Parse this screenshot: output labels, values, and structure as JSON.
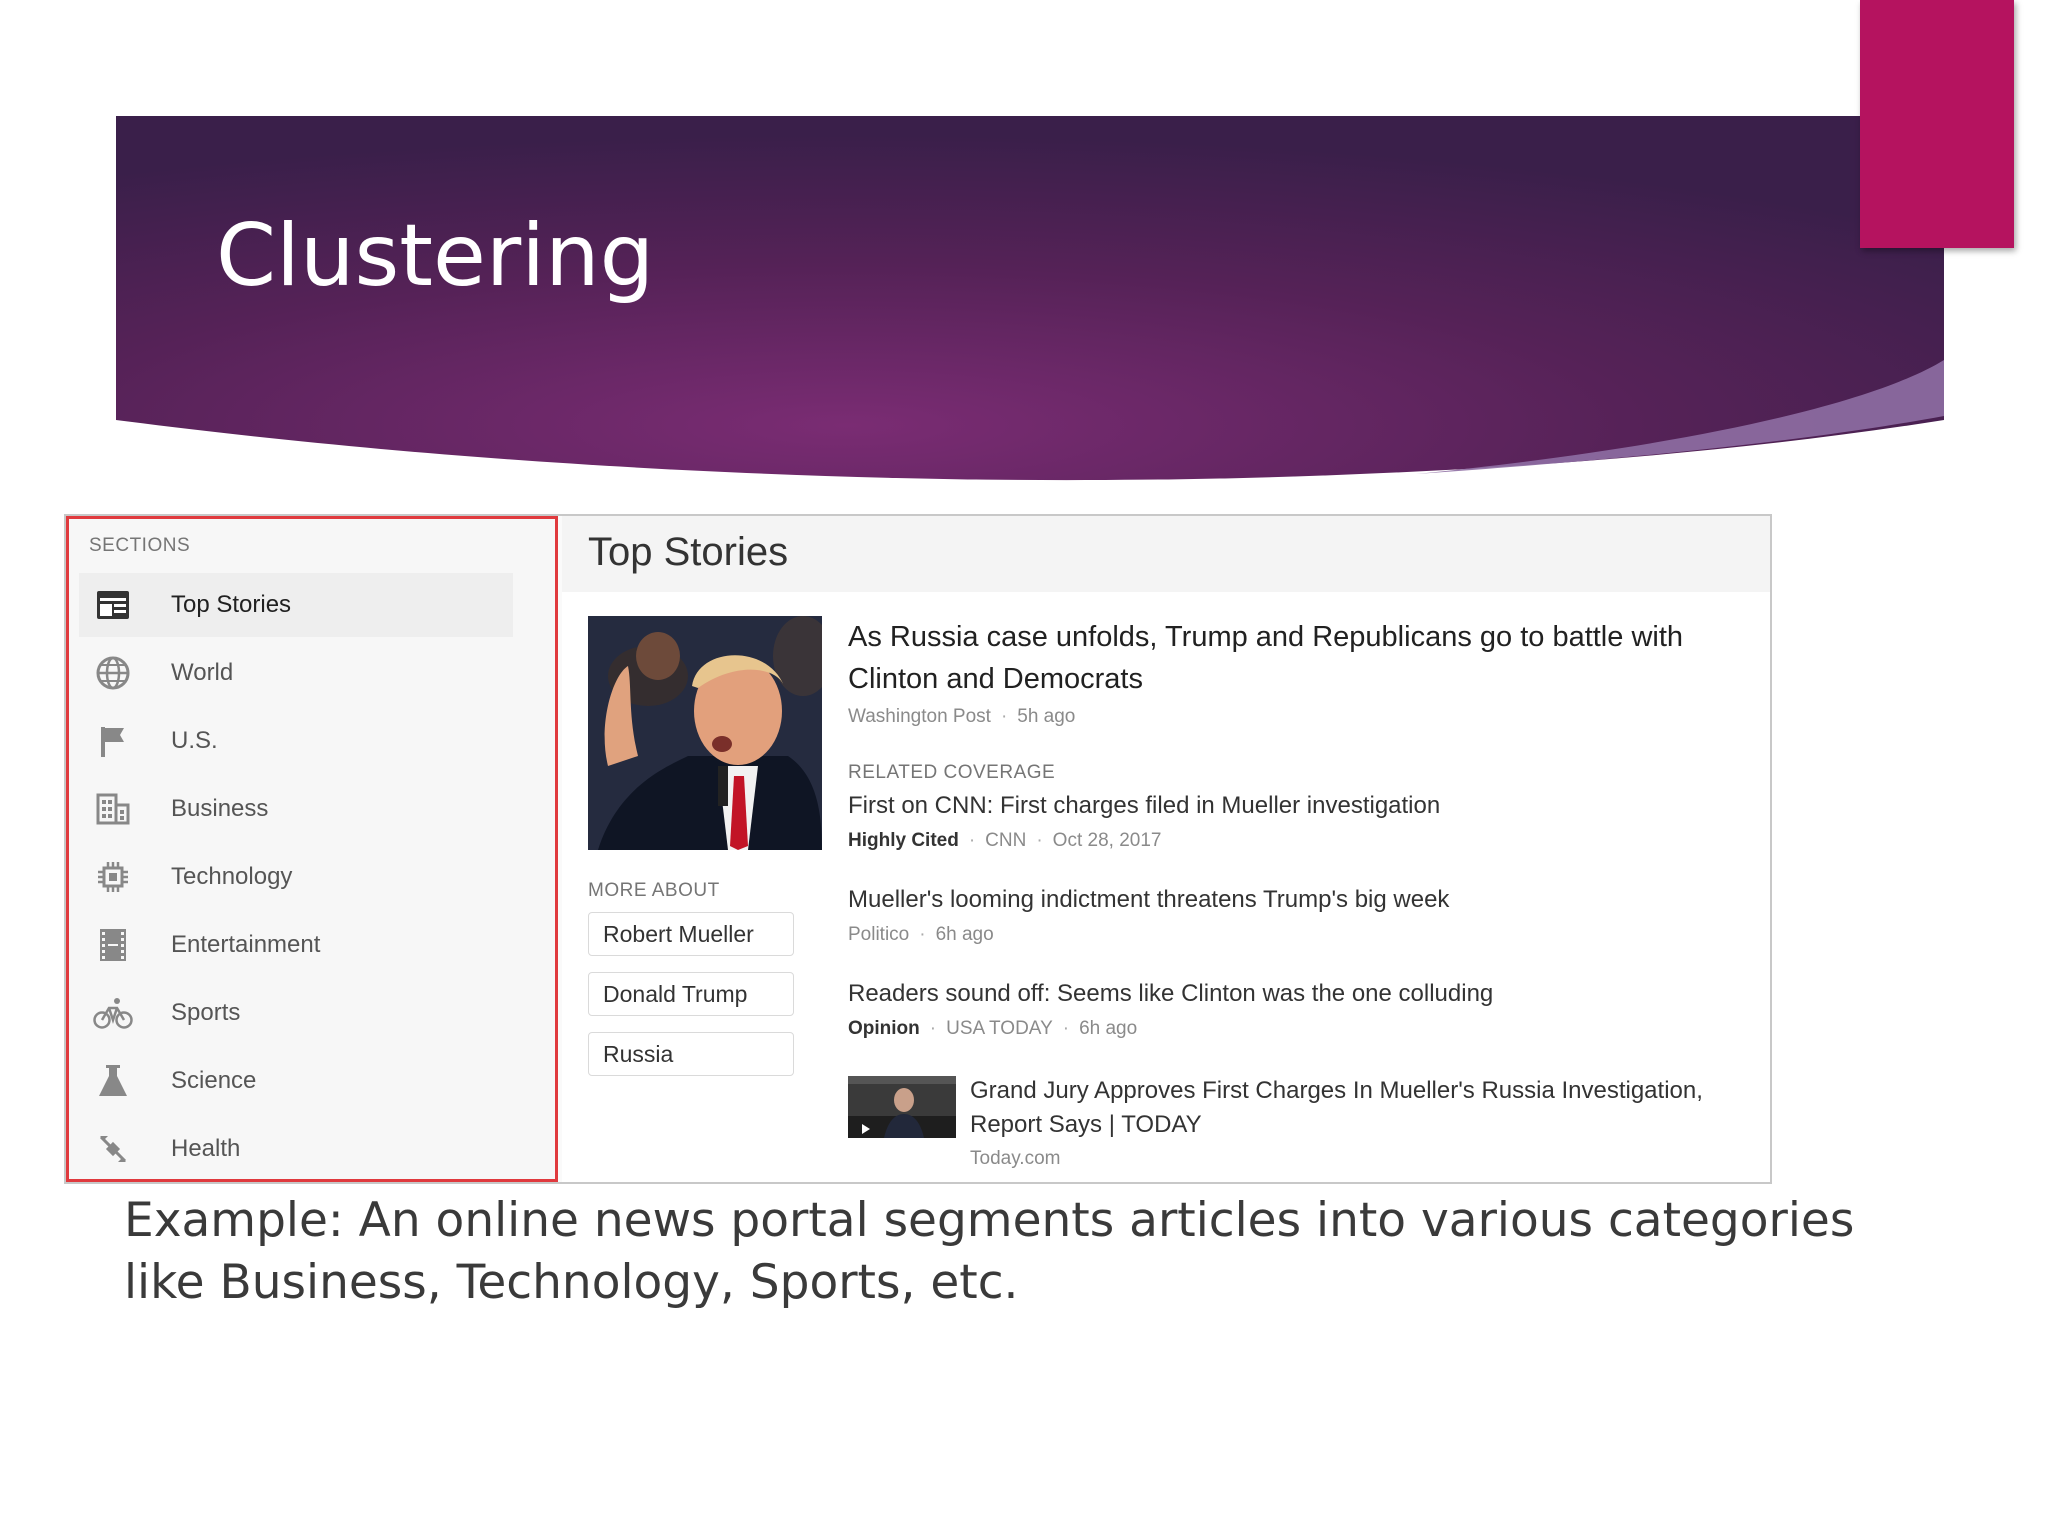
{
  "slide": {
    "title": "Clustering",
    "caption": "Example: An online news portal segments articles into various categories like Business, Technology, Sports, etc.",
    "colors": {
      "banner_dark": "#3b1f4f",
      "banner_mid": "#6b2a6d",
      "accent": "#b5135f",
      "highlight_border": "#e03a3e"
    }
  },
  "sidebar": {
    "heading": "SECTIONS",
    "items": [
      {
        "label": "Top Stories",
        "icon": "newspaper-icon",
        "active": true
      },
      {
        "label": "World",
        "icon": "globe-icon"
      },
      {
        "label": "U.S.",
        "icon": "flag-icon"
      },
      {
        "label": "Business",
        "icon": "building-icon"
      },
      {
        "label": "Technology",
        "icon": "chip-icon"
      },
      {
        "label": "Entertainment",
        "icon": "film-icon"
      },
      {
        "label": "Sports",
        "icon": "bicycle-icon"
      },
      {
        "label": "Science",
        "icon": "flask-icon"
      },
      {
        "label": "Health",
        "icon": "health-icon"
      }
    ]
  },
  "main": {
    "title": "Top Stories",
    "headline": "As Russia case unfolds, Trump and Republicans go to battle with Clinton and Democrats",
    "headline_meta": {
      "source": "Washington Post",
      "time": "5h ago"
    },
    "related_label": "RELATED COVERAGE",
    "related": [
      {
        "title": "First on CNN: First charges filed in Mueller investigation",
        "tag": "Highly Cited",
        "source": "CNN",
        "time": "Oct 28, 2017"
      },
      {
        "title": "Mueller's looming indictment threatens Trump's big week",
        "source": "Politico",
        "time": "6h ago"
      },
      {
        "title": "Readers sound off: Seems like Clinton was the one colluding",
        "tag": "Opinion",
        "source": "USA TODAY",
        "time": "6h ago"
      },
      {
        "title": "Grand Jury Approves First Charges In Mueller's Russia Investigation, Report Says | TODAY",
        "source": "Today.com"
      }
    ],
    "more_about_label": "MORE ABOUT",
    "more_about": [
      "Robert Mueller",
      "Donald Trump",
      "Russia"
    ]
  }
}
